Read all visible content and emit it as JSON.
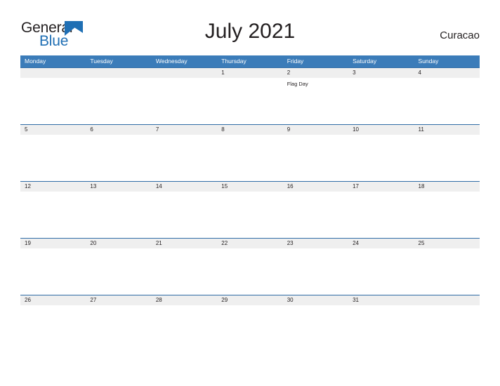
{
  "brand": {
    "name_part1": "General",
    "name_part2": "Blue",
    "flag_icon": "blue-flag-triangle-icon",
    "color_dark": "#231f20",
    "color_blue": "#1f6fb4"
  },
  "header": {
    "title": "July 2021",
    "country": "Curacao"
  },
  "theme": {
    "header_blue": "#3b7cb9",
    "date_band_gray": "#efefef",
    "date_band_border": "#2f6ca6",
    "text_dark": "#231f20",
    "background": "#ffffff"
  },
  "calendar": {
    "weekdays": [
      "Monday",
      "Tuesday",
      "Wednesday",
      "Thursday",
      "Friday",
      "Saturday",
      "Sunday"
    ],
    "weeks": [
      {
        "days": [
          {
            "num": "",
            "events": []
          },
          {
            "num": "",
            "events": []
          },
          {
            "num": "",
            "events": []
          },
          {
            "num": "1",
            "events": []
          },
          {
            "num": "2",
            "events": [
              "Flag Day"
            ]
          },
          {
            "num": "3",
            "events": []
          },
          {
            "num": "4",
            "events": []
          }
        ]
      },
      {
        "days": [
          {
            "num": "5",
            "events": []
          },
          {
            "num": "6",
            "events": []
          },
          {
            "num": "7",
            "events": []
          },
          {
            "num": "8",
            "events": []
          },
          {
            "num": "9",
            "events": []
          },
          {
            "num": "10",
            "events": []
          },
          {
            "num": "11",
            "events": []
          }
        ]
      },
      {
        "days": [
          {
            "num": "12",
            "events": []
          },
          {
            "num": "13",
            "events": []
          },
          {
            "num": "14",
            "events": []
          },
          {
            "num": "15",
            "events": []
          },
          {
            "num": "16",
            "events": []
          },
          {
            "num": "17",
            "events": []
          },
          {
            "num": "18",
            "events": []
          }
        ]
      },
      {
        "days": [
          {
            "num": "19",
            "events": []
          },
          {
            "num": "20",
            "events": []
          },
          {
            "num": "21",
            "events": []
          },
          {
            "num": "22",
            "events": []
          },
          {
            "num": "23",
            "events": []
          },
          {
            "num": "24",
            "events": []
          },
          {
            "num": "25",
            "events": []
          }
        ]
      },
      {
        "days": [
          {
            "num": "26",
            "events": []
          },
          {
            "num": "27",
            "events": []
          },
          {
            "num": "28",
            "events": []
          },
          {
            "num": "29",
            "events": []
          },
          {
            "num": "30",
            "events": []
          },
          {
            "num": "31",
            "events": []
          },
          {
            "num": "",
            "events": []
          }
        ]
      }
    ]
  }
}
